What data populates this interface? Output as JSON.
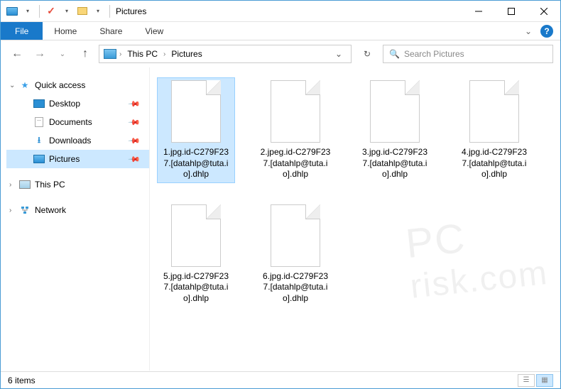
{
  "title": "Pictures",
  "ribbon": {
    "file": "File",
    "tabs": [
      "Home",
      "Share",
      "View"
    ]
  },
  "breadcrumb": {
    "segments": [
      "This PC",
      "Pictures"
    ]
  },
  "search": {
    "placeholder": "Search Pictures"
  },
  "sidebar": {
    "quick_access": "Quick access",
    "items": [
      {
        "label": "Desktop",
        "pinned": true
      },
      {
        "label": "Documents",
        "pinned": true
      },
      {
        "label": "Downloads",
        "pinned": true
      },
      {
        "label": "Pictures",
        "pinned": true,
        "selected": true
      }
    ],
    "this_pc": "This PC",
    "network": "Network"
  },
  "files": [
    {
      "name": "1.jpg.id-C279F237.[datahlp@tuta.io].dhlp",
      "selected": true
    },
    {
      "name": "2.jpeg.id-C279F237.[datahlp@tuta.io].dhlp"
    },
    {
      "name": "3.jpg.id-C279F237.[datahlp@tuta.io].dhlp"
    },
    {
      "name": "4.jpg.id-C279F237.[datahlp@tuta.io].dhlp"
    },
    {
      "name": "5.jpg.id-C279F237.[datahlp@tuta.io].dhlp"
    },
    {
      "name": "6.jpg.id-C279F237.[datahlp@tuta.io].dhlp"
    }
  ],
  "status": {
    "count_label": "6 items"
  },
  "watermark": {
    "line1": "PC",
    "line2": "risk.com"
  }
}
